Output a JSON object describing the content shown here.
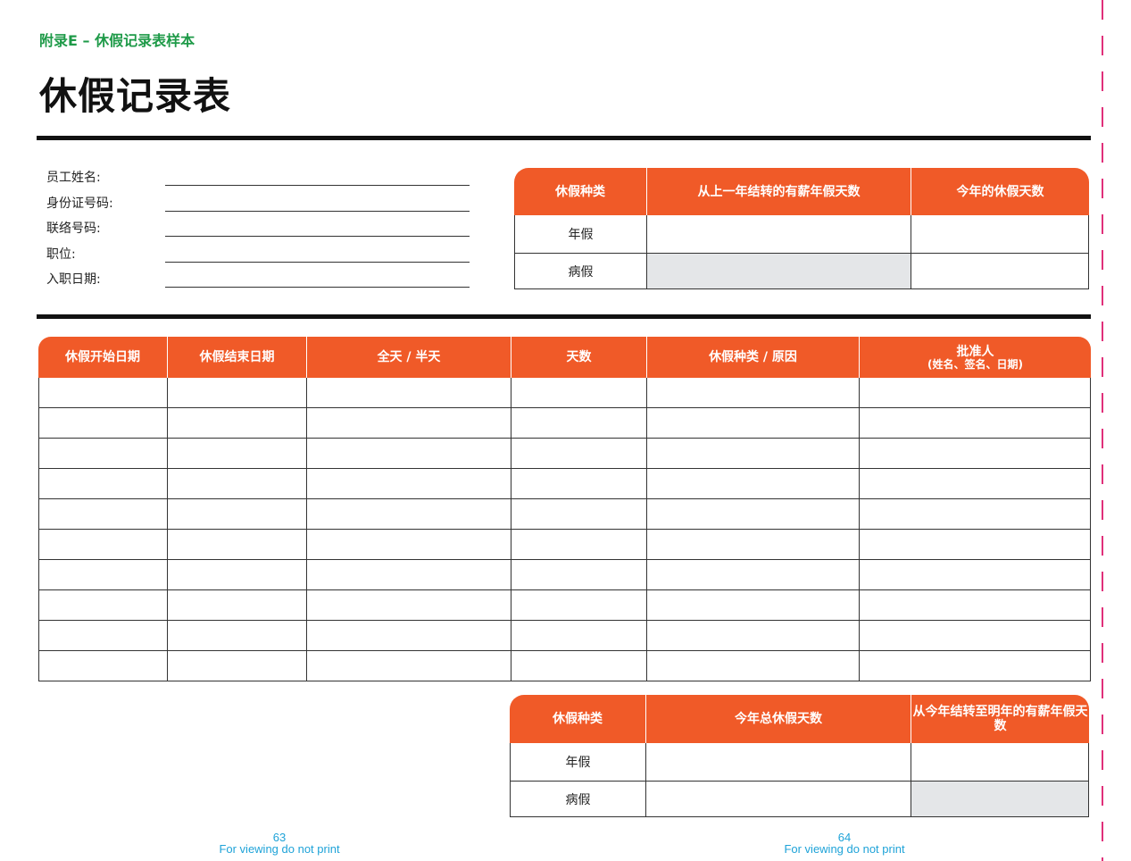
{
  "header": {
    "appendix": "附录E – 休假记录表样本",
    "title": "休假记录表"
  },
  "employee_fields": [
    {
      "label": "员工姓名:",
      "value": ""
    },
    {
      "label": "身份证号码:",
      "value": ""
    },
    {
      "label": "联络号码:",
      "value": ""
    },
    {
      "label": "职位:",
      "value": ""
    },
    {
      "label": "入职日期:",
      "value": ""
    }
  ],
  "balance_table": {
    "headers": [
      "休假种类",
      "从上一年结转的有薪年假天数",
      "今年的休假天数"
    ],
    "rows": [
      [
        "年假",
        "",
        ""
      ],
      [
        "病假",
        "",
        ""
      ]
    ]
  },
  "log_table": {
    "headers": [
      "休假开始日期",
      "休假结束日期",
      "全天 / 半天",
      "天数",
      "休假种类 / 原因",
      "批准人"
    ],
    "approver_sub": "(姓名、签名、日期)",
    "row_count": 10
  },
  "summary_table": {
    "headers": [
      "休假种类",
      "今年总休假天数",
      "从今年结转至明年的有薪年假天数"
    ],
    "rows": [
      [
        "年假",
        "",
        ""
      ],
      [
        "病假",
        "",
        ""
      ]
    ]
  },
  "footer": {
    "left_page": "63",
    "right_page": "64",
    "note": "For viewing do not print"
  },
  "colors": {
    "accent_orange": "#f05a28",
    "appendix_green": "#1e9a48",
    "footer_blue": "#1fa3d8",
    "cutline_pink": "#e0307a",
    "shaded_cell": "#e4e6e8"
  }
}
